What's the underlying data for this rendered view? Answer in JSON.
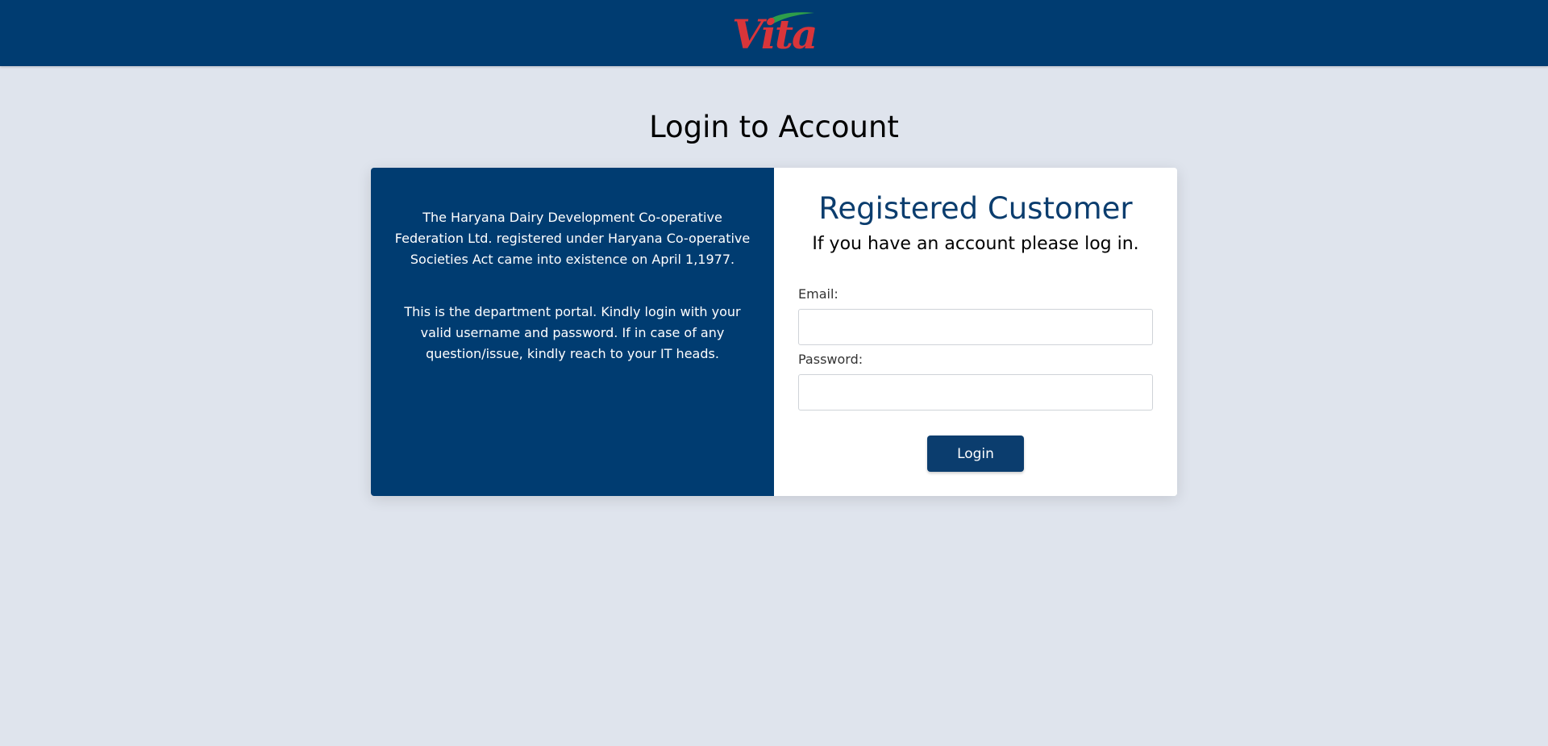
{
  "header": {
    "logo_text": "Vita"
  },
  "page": {
    "title": "Login to Account"
  },
  "info_panel": {
    "paragraph_1": "The Haryana Dairy Development Co-operative Federation Ltd. registered under Haryana Co-operative Societies Act came into existence on April 1,1977.",
    "paragraph_2": "This is the department portal. Kindly login with your valid username and password. If in case of any question/issue, kindly reach to your IT heads."
  },
  "login_form": {
    "heading": "Registered Customer",
    "subheading": "If you have an account please log in.",
    "email_label": "Email:",
    "email_value": "",
    "password_label": "Password:",
    "password_value": "",
    "submit_label": "Login"
  },
  "colors": {
    "header_bg": "#003c71",
    "page_bg": "#dfe4ed",
    "logo_red": "#d9353a",
    "logo_green": "#2e9e4a",
    "button_bg": "#0b3d6e"
  },
  "icons": {
    "logo": "vita-logo"
  }
}
